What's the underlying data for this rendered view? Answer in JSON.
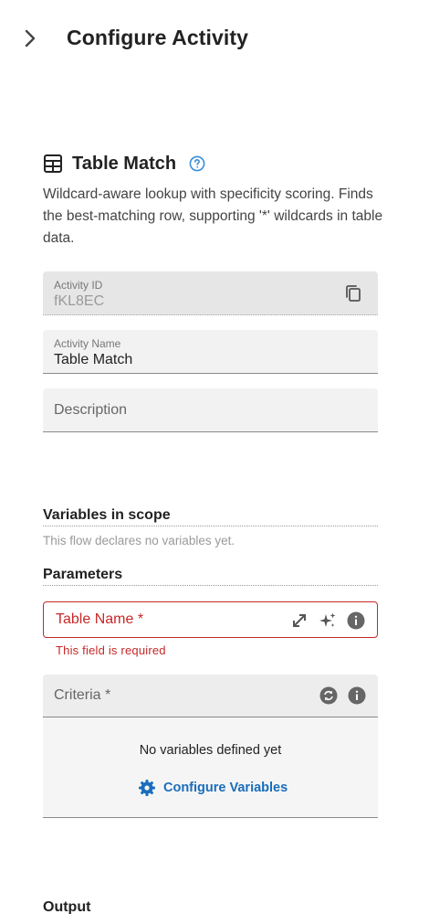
{
  "header": {
    "title": "Configure Activity"
  },
  "activity": {
    "title": "Table Match",
    "description": "Wildcard-aware lookup with specificity scoring. Finds the best-matching row, supporting '*' wildcards in table data."
  },
  "fields": {
    "activity_id": {
      "label": "Activity ID",
      "value": "fKL8EC"
    },
    "activity_name": {
      "label": "Activity Name",
      "value": "Table Match"
    },
    "description": {
      "placeholder": "Description"
    }
  },
  "variables": {
    "title": "Variables in scope",
    "empty_hint": "This flow declares no variables yet."
  },
  "parameters": {
    "title": "Parameters",
    "table_name": {
      "label": "Table Name *",
      "error": "This field is required"
    },
    "criteria": {
      "label": "Criteria *",
      "empty_text": "No variables defined yet",
      "configure_label": "Configure Variables"
    }
  },
  "output": {
    "title": "Output"
  },
  "colors": {
    "error": "#c62828",
    "link": "#1a6dbb",
    "help": "#3a8fd9",
    "icon": "#666666"
  }
}
